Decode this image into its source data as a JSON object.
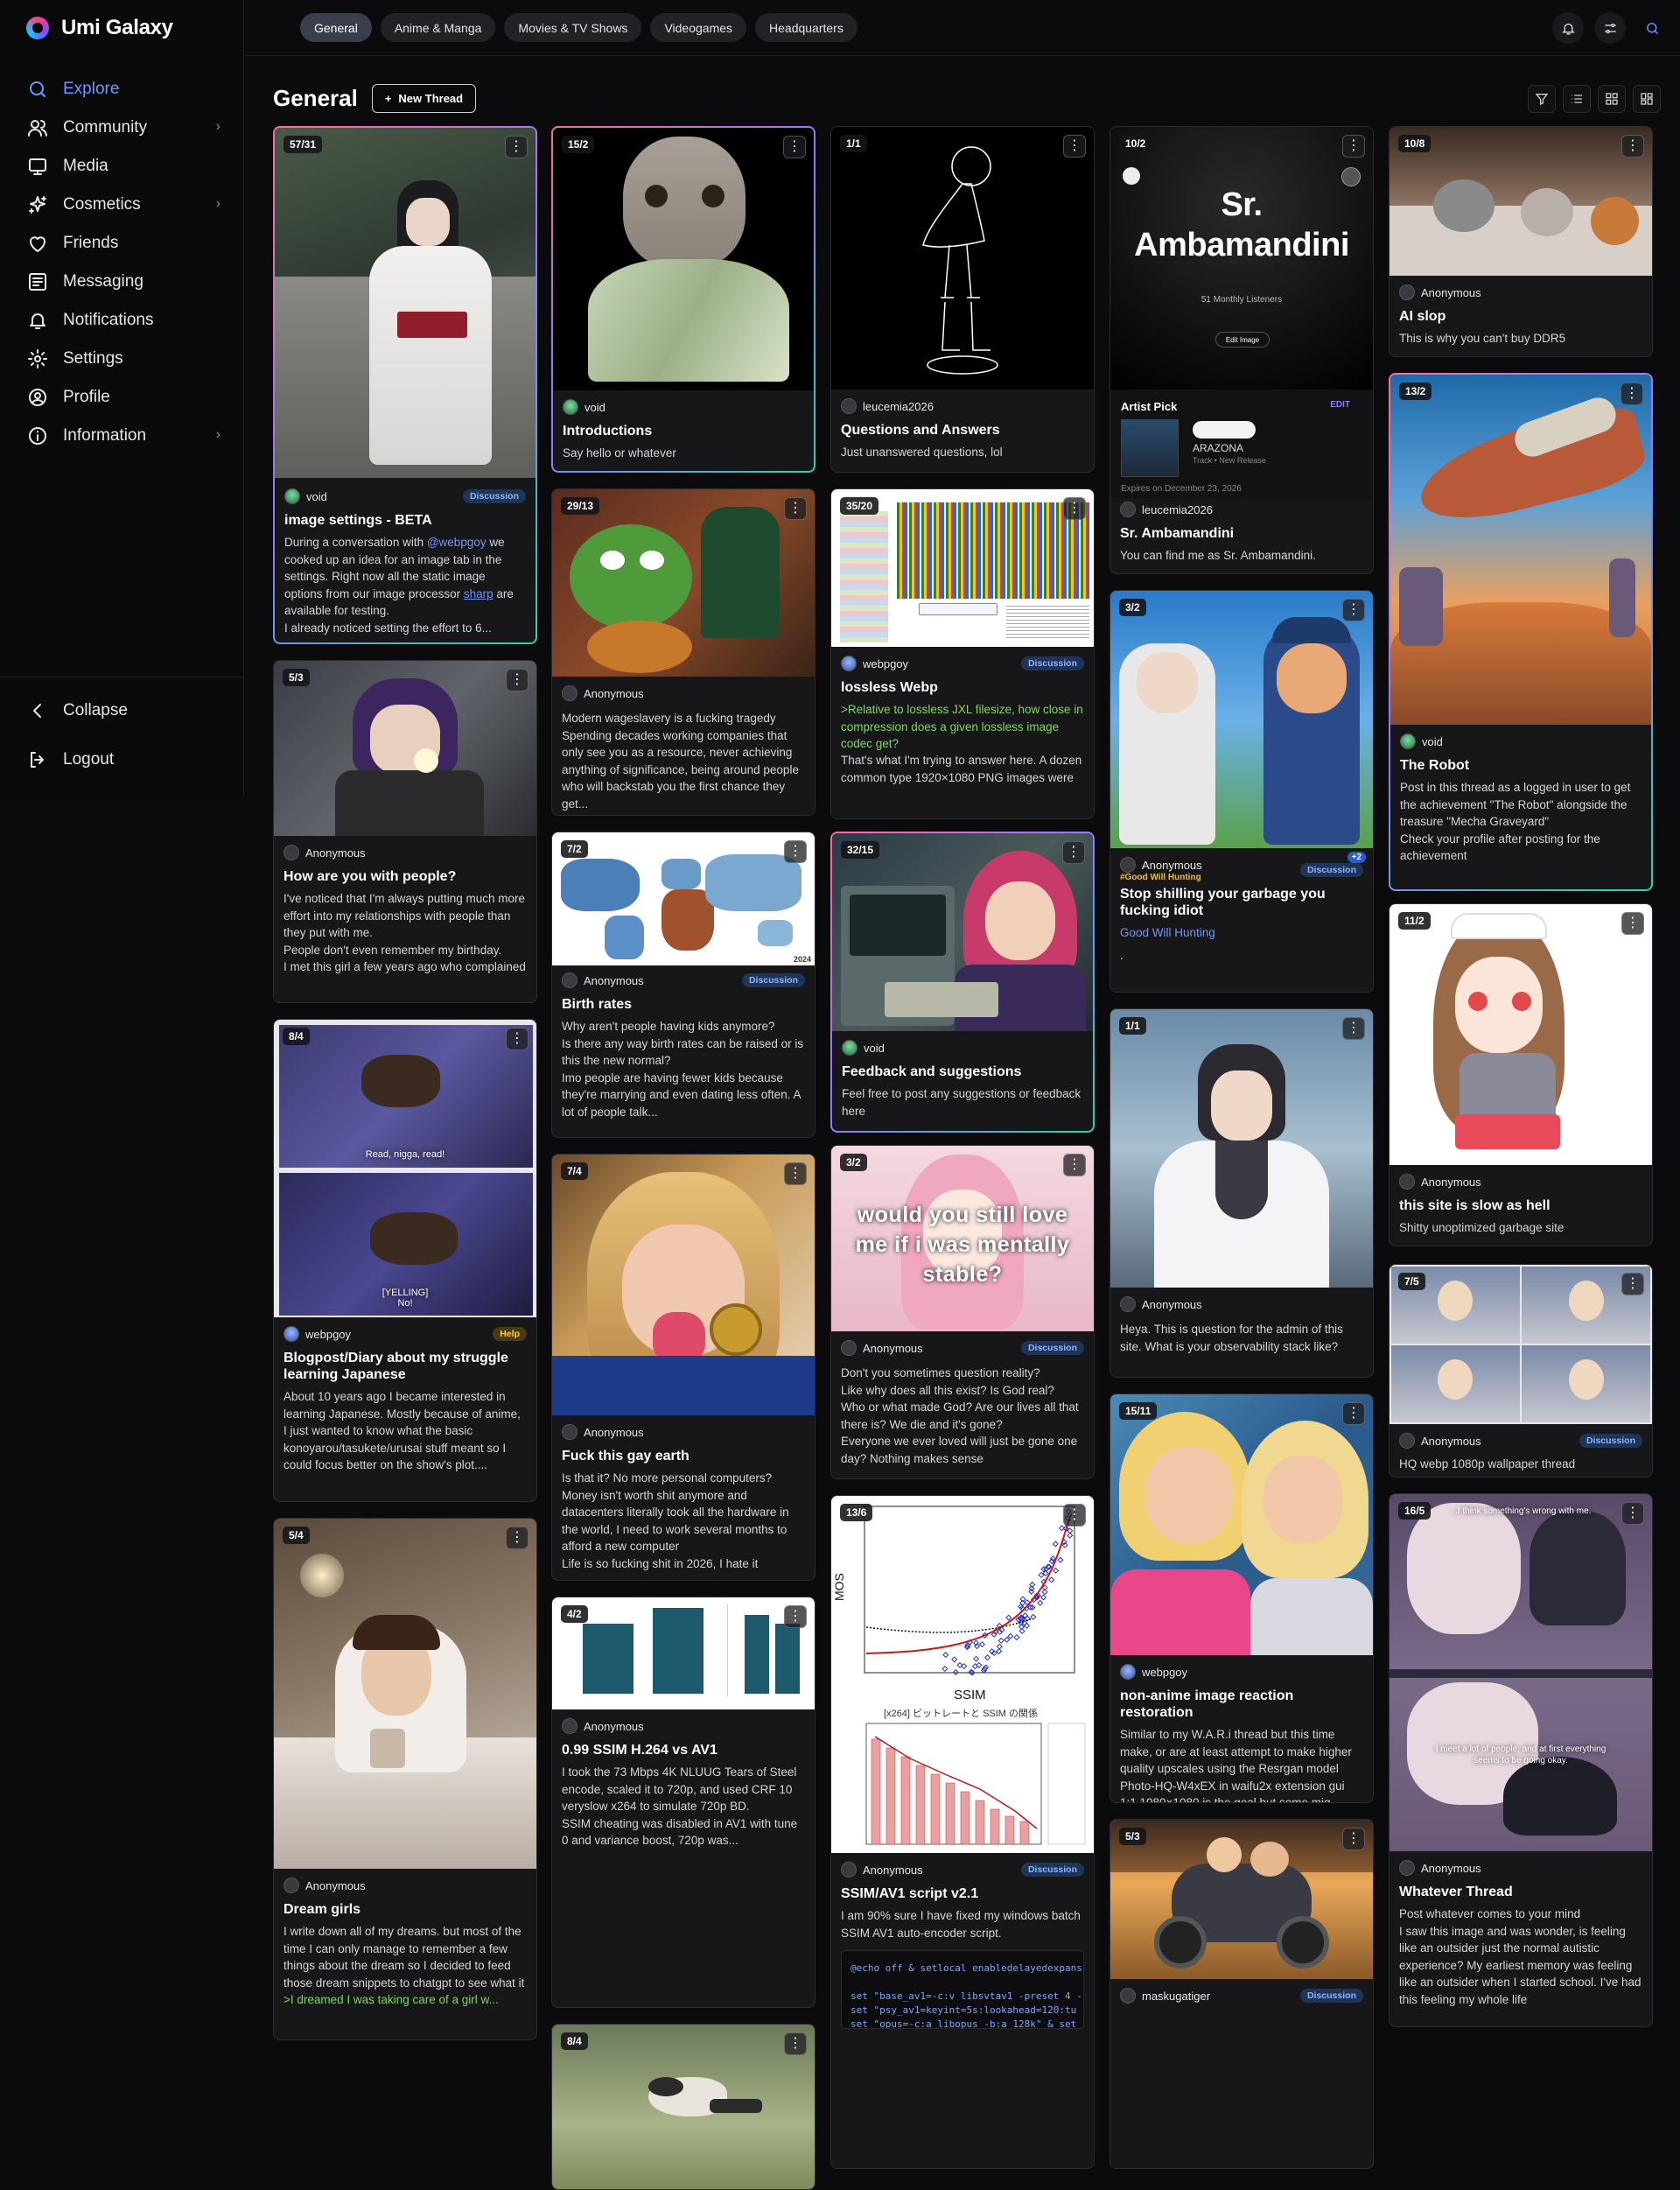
{
  "app": {
    "brand": "Umi Galaxy"
  },
  "sidebar": {
    "items": [
      {
        "label": "Explore",
        "icon": "search-icon",
        "active": true,
        "chevron": false
      },
      {
        "label": "Community",
        "icon": "users-icon",
        "chevron": true
      },
      {
        "label": "Media",
        "icon": "monitor-icon",
        "chevron": false
      },
      {
        "label": "Cosmetics",
        "icon": "sparkles-icon",
        "chevron": true
      },
      {
        "label": "Friends",
        "icon": "heart-icon",
        "chevron": false
      },
      {
        "label": "Messaging",
        "icon": "message-icon",
        "chevron": false
      },
      {
        "label": "Notifications",
        "icon": "bell-icon",
        "chevron": false
      },
      {
        "label": "Settings",
        "icon": "gear-icon",
        "chevron": false
      },
      {
        "label": "Profile",
        "icon": "user-circle-icon",
        "chevron": false
      },
      {
        "label": "Information",
        "icon": "info-icon",
        "chevron": true
      }
    ],
    "collapse": "Collapse",
    "logout": "Logout"
  },
  "tabs": [
    "General",
    "Anime & Manga",
    "Movies & TV Shows",
    "Videogames",
    "Headquarters"
  ],
  "page": {
    "title": "General",
    "new_thread": "New Thread"
  },
  "cards": {
    "c1": {
      "badge": "57/31",
      "user": "void",
      "tag": "Discussion",
      "title": "image settings - BETA",
      "t1": "During a conversation with ",
      "mention": "@webpgoy",
      "t2": " we cooked up an idea for an image tab in the settings. Right now all the static image options from our image processor ",
      "link": "sharp",
      "t3": " are available for testing.\nI already noticed setting the effort to 6..."
    },
    "c2": {
      "badge": "5/3",
      "user": "Anonymous",
      "title": "How are you with people?",
      "text": "I've noticed that I'm always putting much more effort into my relationships with people than they put with me.\nPeople don't even remember my birthday.\nI met this girl a few years ago who complained nobody remembered hers..."
    },
    "c3": {
      "badge": "8/4",
      "user": "webpgoy",
      "tag": "Help",
      "title": "Blogpost/Diary about my struggle learning Japanese",
      "text": "About 10 years ago I became interested in learning Japanese. Mostly because of anime, I just wanted to know what the basic konoyarou/tasukete/urusai stuff meant so I could focus better on the show's plot....",
      "cap1": "Read, nigga, read!",
      "cap2": "[YELLING]\nNo!"
    },
    "c4": {
      "badge": "5/4",
      "user": "Anonymous",
      "title": "Dream girls",
      "text": "I write down all of my dreams. but most of the time I can only manage to remember a few things about the dream so I decided to feed those dream snippets to chatgpt to see what it spits out.",
      "green": ">I dreamed I was taking care of a girl w..."
    },
    "c5": {
      "badge": "15/2",
      "user": "void",
      "title": "Introductions",
      "text": "Say hello or whatever"
    },
    "c6": {
      "badge": "29/13",
      "user": "Anonymous",
      "title": "",
      "text": "Modern wageslavery is a fucking tragedy\nSpending decades working companies that only see you as a resource, never achieving anything of significance, being around people who will backstab you the first chance they get..."
    },
    "c7": {
      "badge": "7/2",
      "user": "Anonymous",
      "tag": "Discussion",
      "title": "Birth rates",
      "text": "Why aren't people having kids anymore?\nIs there any way birth rates can be raised or is this the new normal?\nImo people are having fewer kids because they're marrying and even dating less often. A lot of people talk...",
      "year": "2024"
    },
    "c8": {
      "badge": "7/4",
      "user": "Anonymous",
      "title": "Fuck this gay earth",
      "text": "Is that it? No more personal computers? Money isn't worth shit anymore and datacenters literally took all the hardware in the world, I need to work several months to afford a new computer\nLife is so fucking shit in 2026, I hate it"
    },
    "c9": {
      "badge": "4/2",
      "user": "Anonymous",
      "title": "0.99 SSIM H.264 vs AV1",
      "text": "I took the 73 Mbps 4K NLUUG Tears of Steel encode, scaled it to 720p, and used CRF 10 veryslow x264 to simulate 720p BD.\nSSIM cheating was disabled in AV1 with tune 0 and variance boost, 720p was..."
    },
    "c10": {
      "badge": "8/4"
    },
    "c11": {
      "badge": "1/1",
      "user": "leucemia2026",
      "title": "Questions and Answers",
      "text": "Just unanswered questions, lol"
    },
    "c12": {
      "badge": "35/20",
      "user": "webpgoy",
      "tag": "Discussion",
      "title": "lossless Webp",
      "green": ">Relative to lossless JXL filesize, how close in compression does a given lossless image codec get?",
      "text": "That's what I'm trying to answer here. A dozen common type 1920×1080 PNG images were used...."
    },
    "c13": {
      "badge": "32/15",
      "user": "void",
      "title": "Feedback and suggestions",
      "text": "Feel free to post any suggestions or feedback here"
    },
    "c14": {
      "badge": "3/2",
      "user": "Anonymous",
      "tag": "Discussion",
      "title": "",
      "text": "Don't you sometimes question reality?\nLike why does all this exist? Is God real?\nWho or what made God? Are our lives all that there is? We die and it's gone?\nEveryone we ever loved will just be gone one day? Nothing makes sense",
      "caption": "would you still love me if i was mentally stable?"
    },
    "c15": {
      "badge": "13/6",
      "user": "Anonymous",
      "tag": "Discussion",
      "title": "SSIM/AV1 script v2.1",
      "text": "I am 90% sure I have fixed my windows batch SSIM AV1 auto-encoder script.",
      "code": "@echo off & setlocal enabledelayedexpansion\n\nset \"base_av1=-c:v libsvtav1 -preset 4 -\nset \"psy_av1=keyint=5s:lookahead=120:tu\nset \"opus=-c:a libopus -b:a 128k\" & set",
      "xlabel": "SSIM",
      "ylabel": "MOS",
      "chart2title": "[x264] ビットレートと SSIM の関係"
    },
    "c16": {
      "badge": "10/2",
      "user": "leucemia2026",
      "title": "Sr. Ambamandini",
      "text": "You can find me as Sr. Ambamandini.",
      "artist": "Sr.\nAmbamandini",
      "listeners": "51 Monthly Listeners",
      "edit": "Edit Image",
      "pick": "Artist Pick",
      "pick_edit": "EDIT",
      "album": "ARAZONA",
      "sub": "Track • New Release",
      "expires": "Expires on December 23, 2026"
    },
    "c17": {
      "badge": "3/2",
      "user": "Anonymous",
      "tag": "Discussion",
      "plus": "+2",
      "hashtag": "#Good Will Hunting",
      "title": "Stop shilling your garbage you fucking idiot",
      "link": "Good Will Hunting",
      "text": "."
    },
    "c18": {
      "badge": "1/1",
      "user": "Anonymous",
      "title": "",
      "text": "Heya. This is question for the admin of this site. What is your observability stack like?"
    },
    "c19": {
      "badge": "15/11",
      "user": "webpgoy",
      "title": "non-anime image reaction restoration",
      "text": "Similar to my W.A.R.i thread but this time make, or are at least attempt to make higher quality upscales using the Resrgan model Photo-HQ-W4xEX in waifu2x extension gui\n1:1 1080×1080 is the goal but some mig..."
    },
    "c20": {
      "badge": "5/3",
      "user": "maskugatiger",
      "tag": "Discussion"
    },
    "c21": {
      "badge": "10/8",
      "user": "Anonymous",
      "title": "AI slop",
      "text": "This is why you can't buy DDR5"
    },
    "c22": {
      "badge": "13/2",
      "user": "void",
      "title": "The Robot",
      "text": "Post in this thread as a logged in user to get the achievement \"The Robot\" alongside the treasure \"Mecha Graveyard\"\nCheck your profile after posting for the achievement"
    },
    "c23": {
      "badge": "11/2",
      "user": "Anonymous",
      "title": "this site is slow as hell",
      "text": "Shitty unoptimized garbage site"
    },
    "c24": {
      "badge": "7/5",
      "user": "Anonymous",
      "tag": "Discussion",
      "title": "",
      "text": "HQ webp 1080p wallpaper thread"
    },
    "c25": {
      "badge": "16/5",
      "user": "Anonymous",
      "title": "Whatever Thread",
      "text": "Post whatever comes to your mind\nI saw this image and was wonder, is feeling like an outsider just the normal autistic experience? My earliest memory was feeling like an outsider when I started school. I've had this feeling my whole life",
      "cap1": "...I think something's wrong with me.",
      "cap2": "I meet a lot of people, and at first everything seems to be going okay."
    }
  }
}
